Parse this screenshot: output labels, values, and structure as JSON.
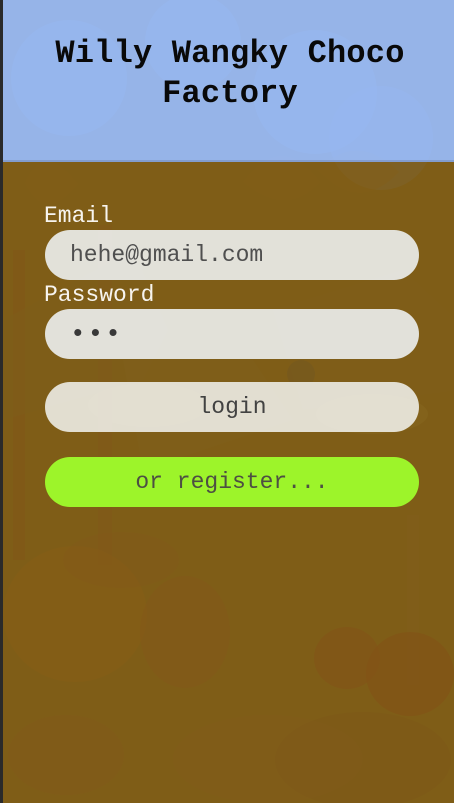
{
  "app": {
    "title": "Willy Wangky Choco Factory"
  },
  "form": {
    "email_label": "Email",
    "email_value": "hehe@gmail.com",
    "password_label": "Password",
    "password_value": "•••",
    "login_label": "login",
    "register_label": "or register..."
  },
  "theme": {
    "header_color": "#97b9f4",
    "overlay_color": "#7c5b16",
    "input_color": "#f0f4f5",
    "register_color": "#9df42a"
  }
}
